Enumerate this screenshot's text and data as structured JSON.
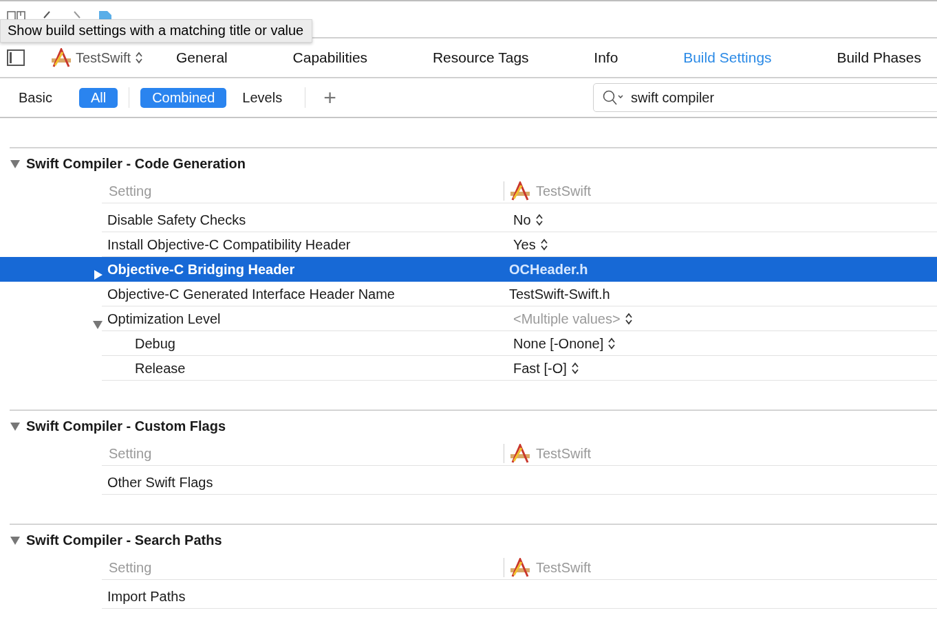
{
  "tooltip": "Show build settings with a matching title or value",
  "target_popup": {
    "label": "TestSwift"
  },
  "tabs": [
    {
      "label": "General",
      "selected": false
    },
    {
      "label": "Capabilities",
      "selected": false
    },
    {
      "label": "Resource Tags",
      "selected": false
    },
    {
      "label": "Info",
      "selected": false
    },
    {
      "label": "Build Settings",
      "selected": true
    },
    {
      "label": "Build Phases",
      "selected": false
    }
  ],
  "scope_filters": [
    {
      "label": "Basic",
      "selected": false
    },
    {
      "label": "All",
      "selected": true
    }
  ],
  "view_filters": [
    {
      "label": "Combined",
      "selected": true
    },
    {
      "label": "Levels",
      "selected": false
    }
  ],
  "add_button": "+",
  "search": {
    "value": "swift compiler"
  },
  "sections": [
    {
      "title": "Swift Compiler - Code Generation",
      "expanded": true,
      "header": {
        "setting": "Setting",
        "target": "TestSwift"
      },
      "rows": [
        {
          "name": "Disable Safety Checks",
          "value": "No",
          "kind": "popup",
          "selected": false
        },
        {
          "name": "Install Objective-C Compatibility Header",
          "value": "Yes",
          "kind": "popup",
          "selected": false
        },
        {
          "name": "Objective-C Bridging Header",
          "value": "OCHeader.h",
          "kind": "text",
          "selected": true,
          "expanded": false
        },
        {
          "name": "Objective-C Generated Interface Header Name",
          "value": "TestSwift-Swift.h",
          "kind": "text",
          "selected": false
        },
        {
          "name": "Optimization Level",
          "value": "<Multiple values>",
          "kind": "mixed",
          "selected": false,
          "expanded": true,
          "children": [
            {
              "name": "Debug",
              "value": "None [-Onone]",
              "kind": "popup",
              "selected": false
            },
            {
              "name": "Release",
              "value": "Fast [-O]",
              "kind": "popup",
              "selected": false
            }
          ]
        }
      ]
    },
    {
      "title": "Swift Compiler - Custom Flags",
      "expanded": true,
      "header": {
        "setting": "Setting",
        "target": "TestSwift"
      },
      "rows": [
        {
          "name": "Other Swift Flags",
          "kind": "empty",
          "selected": false
        }
      ]
    },
    {
      "title": "Swift Compiler - Search Paths",
      "expanded": true,
      "header": {
        "setting": "Setting",
        "target": "TestSwift"
      },
      "rows": [
        {
          "name": "Import Paths",
          "kind": "empty",
          "selected": false
        }
      ]
    }
  ]
}
